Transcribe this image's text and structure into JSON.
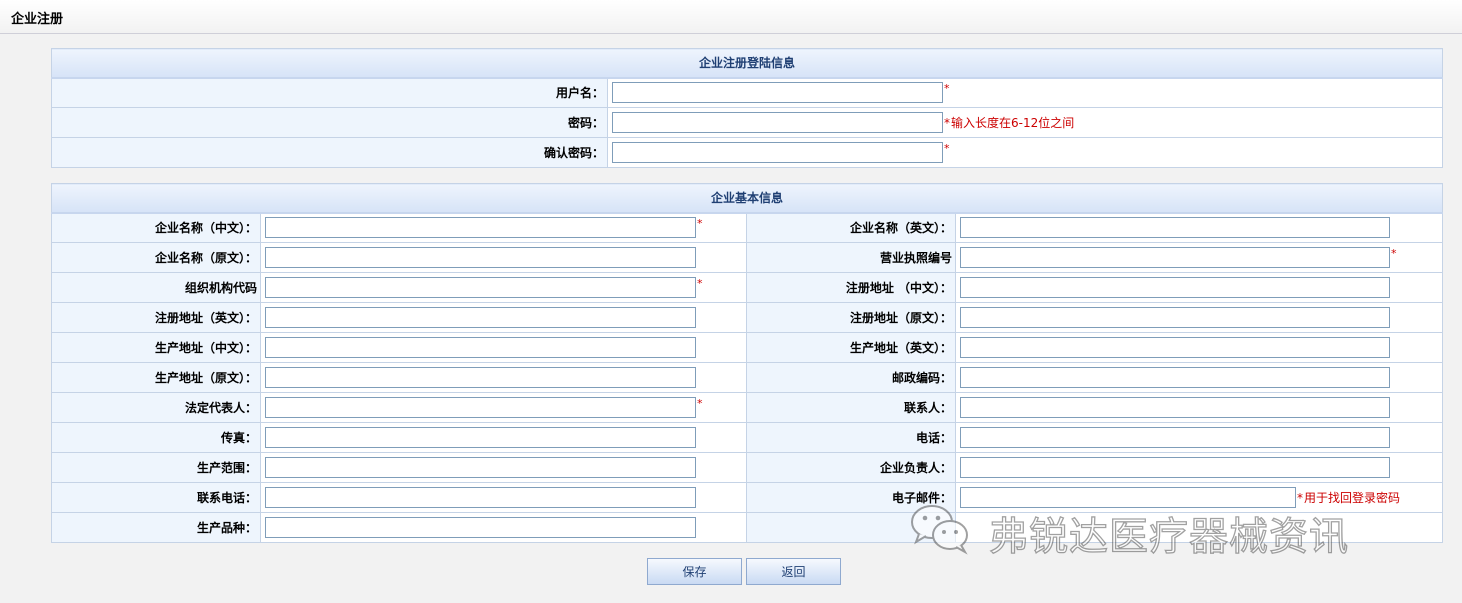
{
  "header": {
    "title": "企业注册"
  },
  "login_section": {
    "title": "企业注册登陆信息",
    "rows": [
      {
        "label": "用户名：",
        "value": "",
        "required": "*",
        "hint": ""
      },
      {
        "label": "密码：",
        "value": "",
        "required": "*",
        "hint": "输入长度在6-12位之间"
      },
      {
        "label": "确认密码：",
        "value": "",
        "required": "*",
        "hint": ""
      }
    ]
  },
  "basic_section": {
    "title": "企业基本信息",
    "rows": [
      {
        "left": {
          "label": "企业名称（中文）：",
          "value": "",
          "required": "*"
        },
        "right": {
          "label": "企业名称（英文）：",
          "value": "",
          "required": "",
          "hint": ""
        }
      },
      {
        "left": {
          "label": "企业名称（原文）：",
          "value": "",
          "required": ""
        },
        "right": {
          "label": "营业执照编号",
          "value": "",
          "required": "*",
          "hint": ""
        }
      },
      {
        "left": {
          "label": "组织机构代码",
          "value": "",
          "required": "*"
        },
        "right": {
          "label": "注册地址 （中文）：",
          "value": "",
          "required": "",
          "hint": ""
        }
      },
      {
        "left": {
          "label": "注册地址（英文）：",
          "value": "",
          "required": ""
        },
        "right": {
          "label": "注册地址（原文）：",
          "value": "",
          "required": "",
          "hint": ""
        }
      },
      {
        "left": {
          "label": "生产地址（中文）：",
          "value": "",
          "required": ""
        },
        "right": {
          "label": "生产地址（英文）：",
          "value": "",
          "required": "",
          "hint": ""
        }
      },
      {
        "left": {
          "label": "生产地址（原文）：",
          "value": "",
          "required": ""
        },
        "right": {
          "label": "邮政编码：",
          "value": "",
          "required": "",
          "hint": ""
        }
      },
      {
        "left": {
          "label": "法定代表人：",
          "value": "",
          "required": "*"
        },
        "right": {
          "label": "联系人：",
          "value": "",
          "required": "",
          "hint": ""
        }
      },
      {
        "left": {
          "label": "传真：",
          "value": "",
          "required": ""
        },
        "right": {
          "label": "电话：",
          "value": "",
          "required": "",
          "hint": ""
        }
      },
      {
        "left": {
          "label": "生产范围：",
          "value": "",
          "required": ""
        },
        "right": {
          "label": "企业负责人：",
          "value": "",
          "required": "",
          "hint": ""
        }
      },
      {
        "left": {
          "label": "联系电话：",
          "value": "",
          "required": ""
        },
        "right": {
          "label": "电子邮件：",
          "value": "",
          "required": "*",
          "hint": "用于找回登录密码"
        }
      },
      {
        "left": {
          "label": "生产品种：",
          "value": "",
          "required": ""
        },
        "right": null
      }
    ]
  },
  "actions": {
    "save_label": "保存",
    "back_label": "返回"
  },
  "watermark": {
    "text": "弗锐达医疗器械资讯",
    "icon": "wechat-icon"
  },
  "colors": {
    "required": "#cc0000",
    "section_header": "#d6e3f7",
    "label_bg": "#eef5fd",
    "border": "#c5d3e6"
  }
}
